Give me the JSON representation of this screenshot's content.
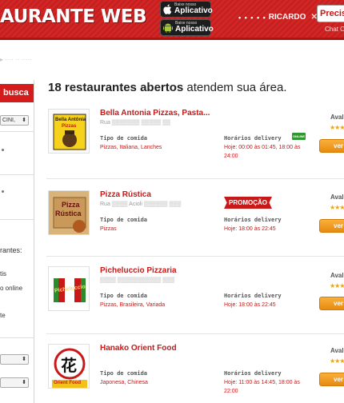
{
  "header": {
    "logo": "AURANTE WEB",
    "app_store": {
      "small": "Baixe nosso",
      "big": "Aplicativo"
    },
    "google_play": {
      "small": "Baixe nosso",
      "big": "Aplicativo"
    },
    "user": {
      "dots": "• • • • •",
      "name": "RICARDO",
      "close": "✕"
    },
    "precise_button": "Precis",
    "chat_link": "Chat O"
  },
  "breadcrumb": "▸ ···· ·· ·····",
  "sidebar": {
    "title": "busca",
    "select_1": "CINI,",
    "section_restaurants": "rantes:",
    "item_1": "tis",
    "item_2": "o online",
    "item_3": "te",
    "select_2": "",
    "select_3": ""
  },
  "main": {
    "heading_bold": "18 restaurantes abertos",
    "heading_rest": " atendem sua área.",
    "labels": {
      "food_type": "Tipo de comida",
      "delivery_hours": "Horários delivery",
      "evaluation": "Aval",
      "view_button": "ver"
    },
    "restaurants": [
      {
        "name": "Bella Antonia Pizzas, Pasta...",
        "address": "Rua ▒▒▒▒▒▒▒ ▒▒▒▒▒ ▒▒",
        "food": "Pizzas, Italiana, Lanches",
        "hours_1": "Hoje: 00:00 às 01:45, 18:00 às",
        "hours_2": "24:00",
        "tag": "ONLINE",
        "stars": "★★★",
        "logo_line1": "Bella Antônia",
        "logo_line2": "Pizzas"
      },
      {
        "name": "Pizza Rústica",
        "address": "Rua ▒▒▒▒ Acioli ▒▒▒▒▒▒ ▒▒▒",
        "food": "Pizzas",
        "hours_1": "Hoje: 18:00 às 22:45",
        "hours_2": "",
        "tag": "PROMOÇÃO",
        "stars": "★★★",
        "logo_line1": "Pizza",
        "logo_line2": "Rústica"
      },
      {
        "name": "Picheluccio Pizzaria",
        "address": "▒▒▒▒ ▒▒▒▒▒▒▒▒▒▒▒ ▒▒▒",
        "food": "Pizzas, Brasileira, Variada",
        "hours_1": "Hoje: 18:00 às 22:45",
        "hours_2": "",
        "tag": "",
        "stars": "★★★",
        "logo_line1": "Picheluccio",
        "logo_line2": ""
      },
      {
        "name": "Hanako Orient Food",
        "address": "",
        "food": "Japonesa, Chinesa",
        "hours_1": "Hoje: 11:00 às 14:45, 18:00 às",
        "hours_2": "22:00",
        "tag": "",
        "stars": "★★★",
        "logo_line1": "花",
        "logo_line2": "Orient Food"
      }
    ]
  },
  "colors": {
    "brand_red": "#cf1f1f",
    "link_red": "#c81818",
    "button_orange": "#f0a020",
    "online_green": "#2e9a2e",
    "star_gold": "#e9a50f"
  }
}
